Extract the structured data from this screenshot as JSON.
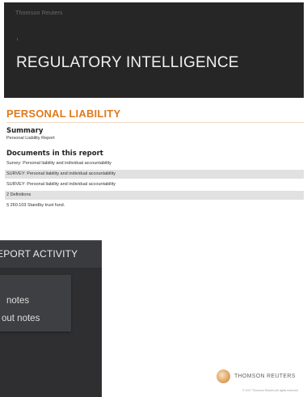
{
  "report": {
    "kicker": "Thomson Reuters",
    "title": "REGULATORY INTELLIGENCE",
    "section_title": "PERSONAL LIABILITY",
    "summary_heading": "Summary",
    "summary_text": "Personal Liability Report",
    "documents_heading": "Documents in this report",
    "documents": [
      {
        "text": "Survey: Personal liability and individual accountability",
        "shaded": false
      },
      {
        "text": "SURVEY: Personal liability and individual accountability",
        "shaded": true
      },
      {
        "text": "SURVEY: Personal liability and individual accountability",
        "shaded": false
      },
      {
        "text": "2 Definitions",
        "shaded": true
      },
      {
        "text": "§ 260.103 Standby trust fund.",
        "shaded": false
      }
    ],
    "brand": "THOMSON REUTERS",
    "footer": "© 2017 Thomson Reuters All rights reserved"
  },
  "activity_panel": {
    "header": "EPORT ACTIVITY",
    "menu": [
      {
        "label": "notes"
      },
      {
        "label": "out notes"
      }
    ]
  },
  "colors": {
    "hero_bg": "#262626",
    "accent": "#e07a1c",
    "panel_bg": "#2f2f31"
  }
}
